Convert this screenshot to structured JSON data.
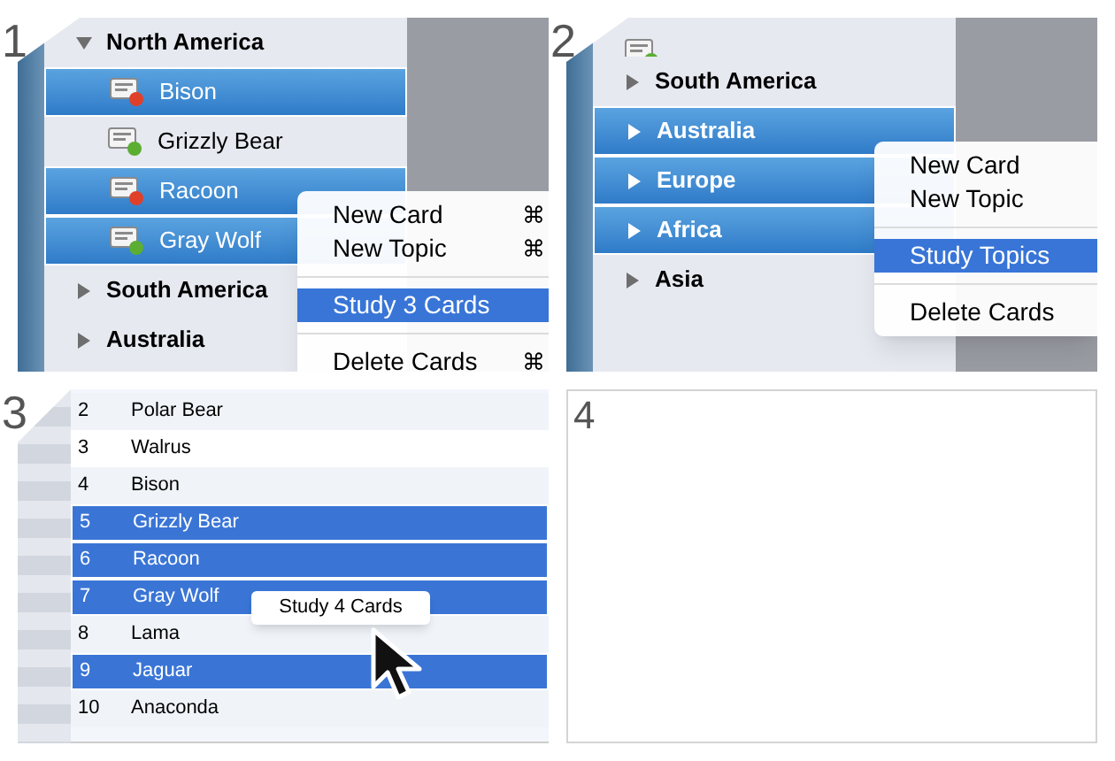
{
  "panels": [
    {
      "number": "1",
      "kind": "outline",
      "rows": [
        {
          "kind": "topic",
          "label": "North America",
          "expanded": true,
          "selected": false,
          "children": [
            {
              "kind": "card",
              "label": "Bison",
              "color": "#e0402a",
              "selected": true
            },
            {
              "kind": "card",
              "label": "Grizzly Bear",
              "color": "#5cae32",
              "selected": false
            },
            {
              "kind": "card",
              "label": "Racoon",
              "color": "#e0402a",
              "selected": true
            },
            {
              "kind": "card",
              "label": "Gray Wolf",
              "color": "#5cae32",
              "selected": true
            }
          ]
        },
        {
          "kind": "topic",
          "label": "South America",
          "expanded": false,
          "selected": false
        },
        {
          "kind": "topic",
          "label": "Australia",
          "expanded": false,
          "selected": false
        }
      ],
      "menu": {
        "items": [
          {
            "kind": "item",
            "label": "New Card",
            "shortcut": "⌘",
            "selected": false
          },
          {
            "kind": "item",
            "label": "New Topic",
            "shortcut": "⌘",
            "selected": false
          },
          {
            "kind": "separator"
          },
          {
            "kind": "item",
            "label": "Study 3 Cards",
            "selected": true
          },
          {
            "kind": "separator"
          },
          {
            "kind": "item",
            "label": "Delete Cards",
            "shortcut": "⌘",
            "selected": false
          }
        ]
      }
    },
    {
      "number": "2",
      "kind": "outline",
      "rows": [
        {
          "kind": "card",
          "color": "#5cae32",
          "selected": false
        },
        {
          "kind": "topic",
          "label": "South America",
          "expanded": false,
          "selected": false
        },
        {
          "kind": "topic",
          "label": "Australia",
          "expanded": false,
          "selected": true
        },
        {
          "kind": "topic",
          "label": "Europe",
          "expanded": false,
          "selected": true
        },
        {
          "kind": "topic",
          "label": "Africa",
          "expanded": false,
          "selected": true
        },
        {
          "kind": "topic",
          "label": "Asia",
          "expanded": false,
          "selected": false
        }
      ],
      "menu": {
        "items": [
          {
            "kind": "item",
            "label": "New Card",
            "selected": false
          },
          {
            "kind": "item",
            "label": "New Topic",
            "selected": false
          },
          {
            "kind": "separator"
          },
          {
            "kind": "item",
            "label": "Study Topics",
            "selected": true
          },
          {
            "kind": "separator"
          },
          {
            "kind": "item",
            "label": "Delete Cards",
            "selected": false
          }
        ]
      }
    },
    {
      "number": "3",
      "kind": "table",
      "rows": [
        {
          "number": "2",
          "name": "Polar Bear",
          "selected": false
        },
        {
          "number": "3",
          "name": "Walrus",
          "selected": false
        },
        {
          "number": "4",
          "name": "Bison",
          "selected": false
        },
        {
          "number": "5",
          "name": "Grizzly Bear",
          "selected": true
        },
        {
          "number": "6",
          "name": "Racoon",
          "selected": true
        },
        {
          "number": "7",
          "name": "Gray Wolf",
          "selected": true
        },
        {
          "number": "8",
          "name": "Lama",
          "selected": false
        },
        {
          "number": "9",
          "name": "Jaguar",
          "selected": true
        },
        {
          "number": "10",
          "name": "Anaconda",
          "selected": false
        }
      ],
      "tooltip": "Study 4 Cards"
    },
    {
      "number": "4",
      "kind": "blank"
    }
  ]
}
